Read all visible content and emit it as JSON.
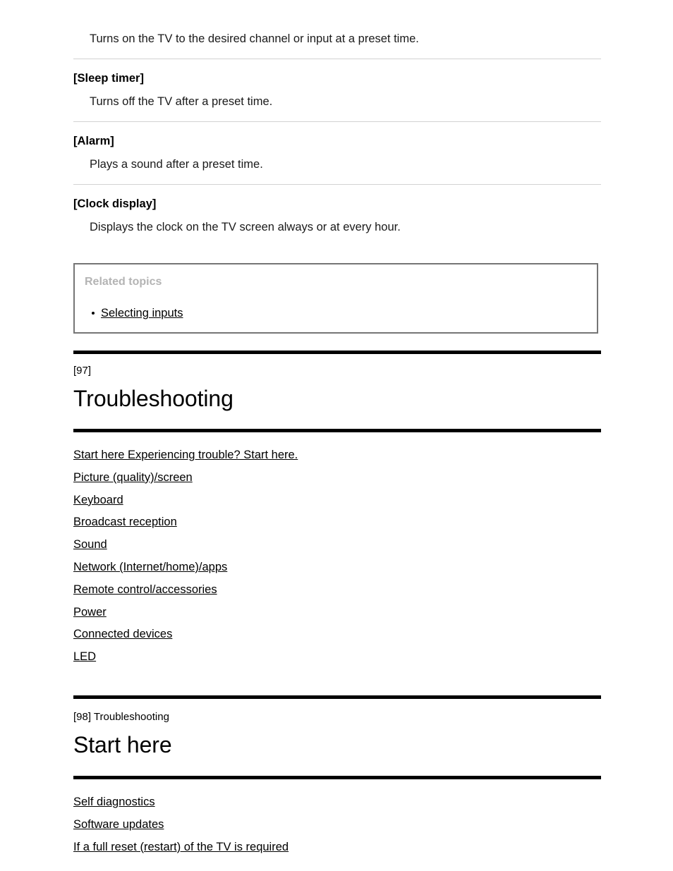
{
  "document": {
    "top_entry_description": "Turns on the TV to the desired channel or input at a preset time.",
    "entries": [
      {
        "term": "[Sleep timer]",
        "description": "Turns off the TV after a preset time."
      },
      {
        "term": "[Alarm]",
        "description": "Plays a sound after a preset time."
      },
      {
        "term": "[Clock display]",
        "description": "Displays the clock on the TV screen always or at every hour."
      }
    ],
    "related_topics": {
      "title": "Related topics",
      "links": [
        "Selecting inputs"
      ]
    },
    "sections": [
      {
        "number": "[97]",
        "crumb": "[97]",
        "title": "Troubleshooting",
        "links": [
          "Start here Experiencing trouble? Start here.",
          "Picture (quality)/screen",
          "Keyboard",
          "Broadcast reception",
          "Sound",
          "Network (Internet/home)/apps",
          "Remote control/accessories",
          "Power",
          "Connected devices",
          "LED"
        ]
      },
      {
        "number": "[98]",
        "crumb": "[98] Troubleshooting",
        "title": "Start here",
        "links": [
          "Self diagnostics",
          "Software updates",
          "If a full reset (restart) of the TV is required"
        ]
      }
    ]
  },
  "colors": {
    "text": "#000000",
    "divider": "#d2d2d2",
    "rule": "#000000",
    "related_title": "#b4b4b4",
    "related_border": "#757575",
    "background": "#ffffff"
  }
}
